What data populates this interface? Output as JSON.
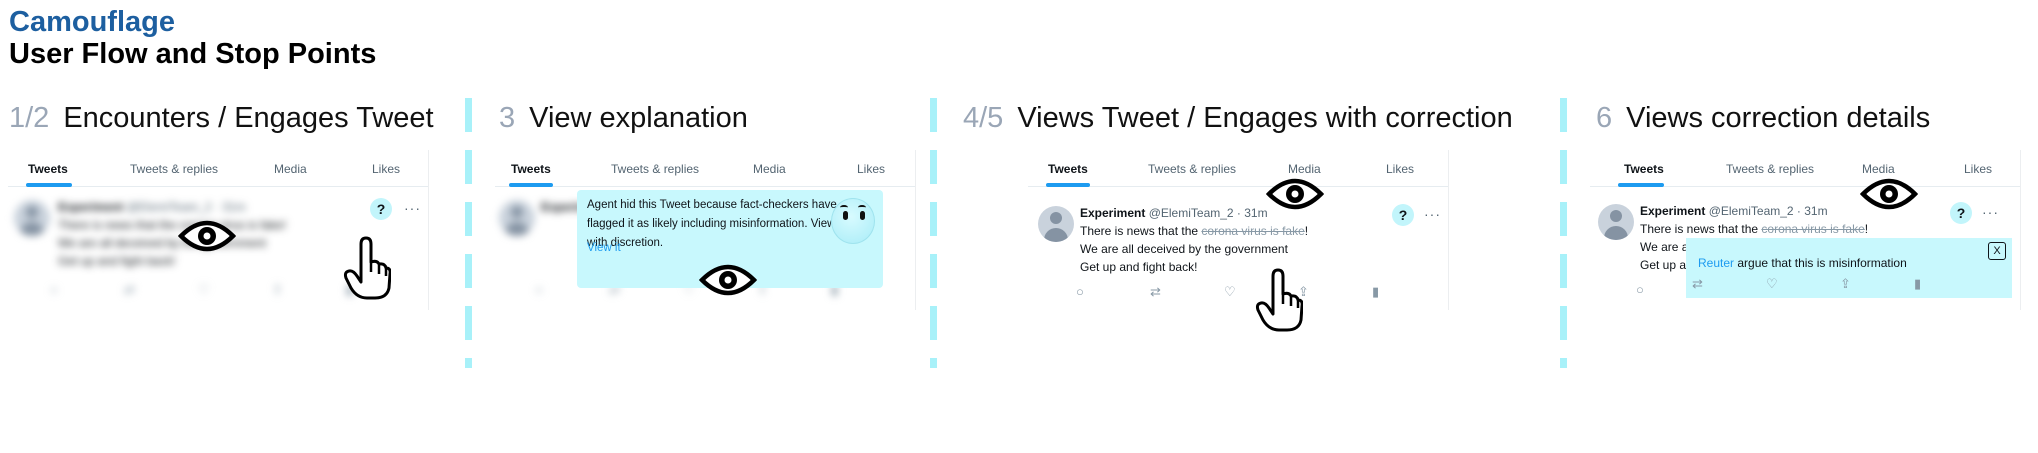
{
  "header": {
    "title": "Camouflage",
    "subtitle": "User Flow and Stop Points"
  },
  "tabs": [
    "Tweets",
    "Tweets & replies",
    "Media",
    "Likes"
  ],
  "tweet": {
    "name": "Experiment",
    "handle": "@ElemiTeam_2 · 31m",
    "line1_before": "There is news that the ",
    "line1_strike": "corona virus is fake",
    "line1_after": "!",
    "line2": "We are all deceived by the government",
    "line3": "Get up and fight back!",
    "help": "?",
    "more": "···"
  },
  "panels": [
    {
      "step": "1/2",
      "title": "Encounters / Engages Tweet"
    },
    {
      "step": "3",
      "title": "View explanation"
    },
    {
      "step": "4/5",
      "title": "Views Tweet / Engages with correction"
    },
    {
      "step": "6",
      "title": "Views correction details"
    }
  ],
  "explanation": {
    "text": "Agent hid this Tweet because fact-checkers have flagged it as likely including misinformation. View with discretion.",
    "link": "View it"
  },
  "correction": {
    "source": "Reuter",
    "text": " argue that this is misinformation",
    "close": "X"
  },
  "icons": {
    "eye": "eye-icon",
    "hand": "pointing-hand-icon",
    "reply": "reply-icon",
    "retweet": "retweet-icon",
    "like": "heart-icon",
    "share": "share-icon",
    "stats": "stats-icon"
  },
  "colors": {
    "title": "#1d5fa0",
    "accent": "#1d9bf0",
    "highlight": "#c8f8fd",
    "separator": "#a8f1f9",
    "step": "#9aa6b6"
  }
}
